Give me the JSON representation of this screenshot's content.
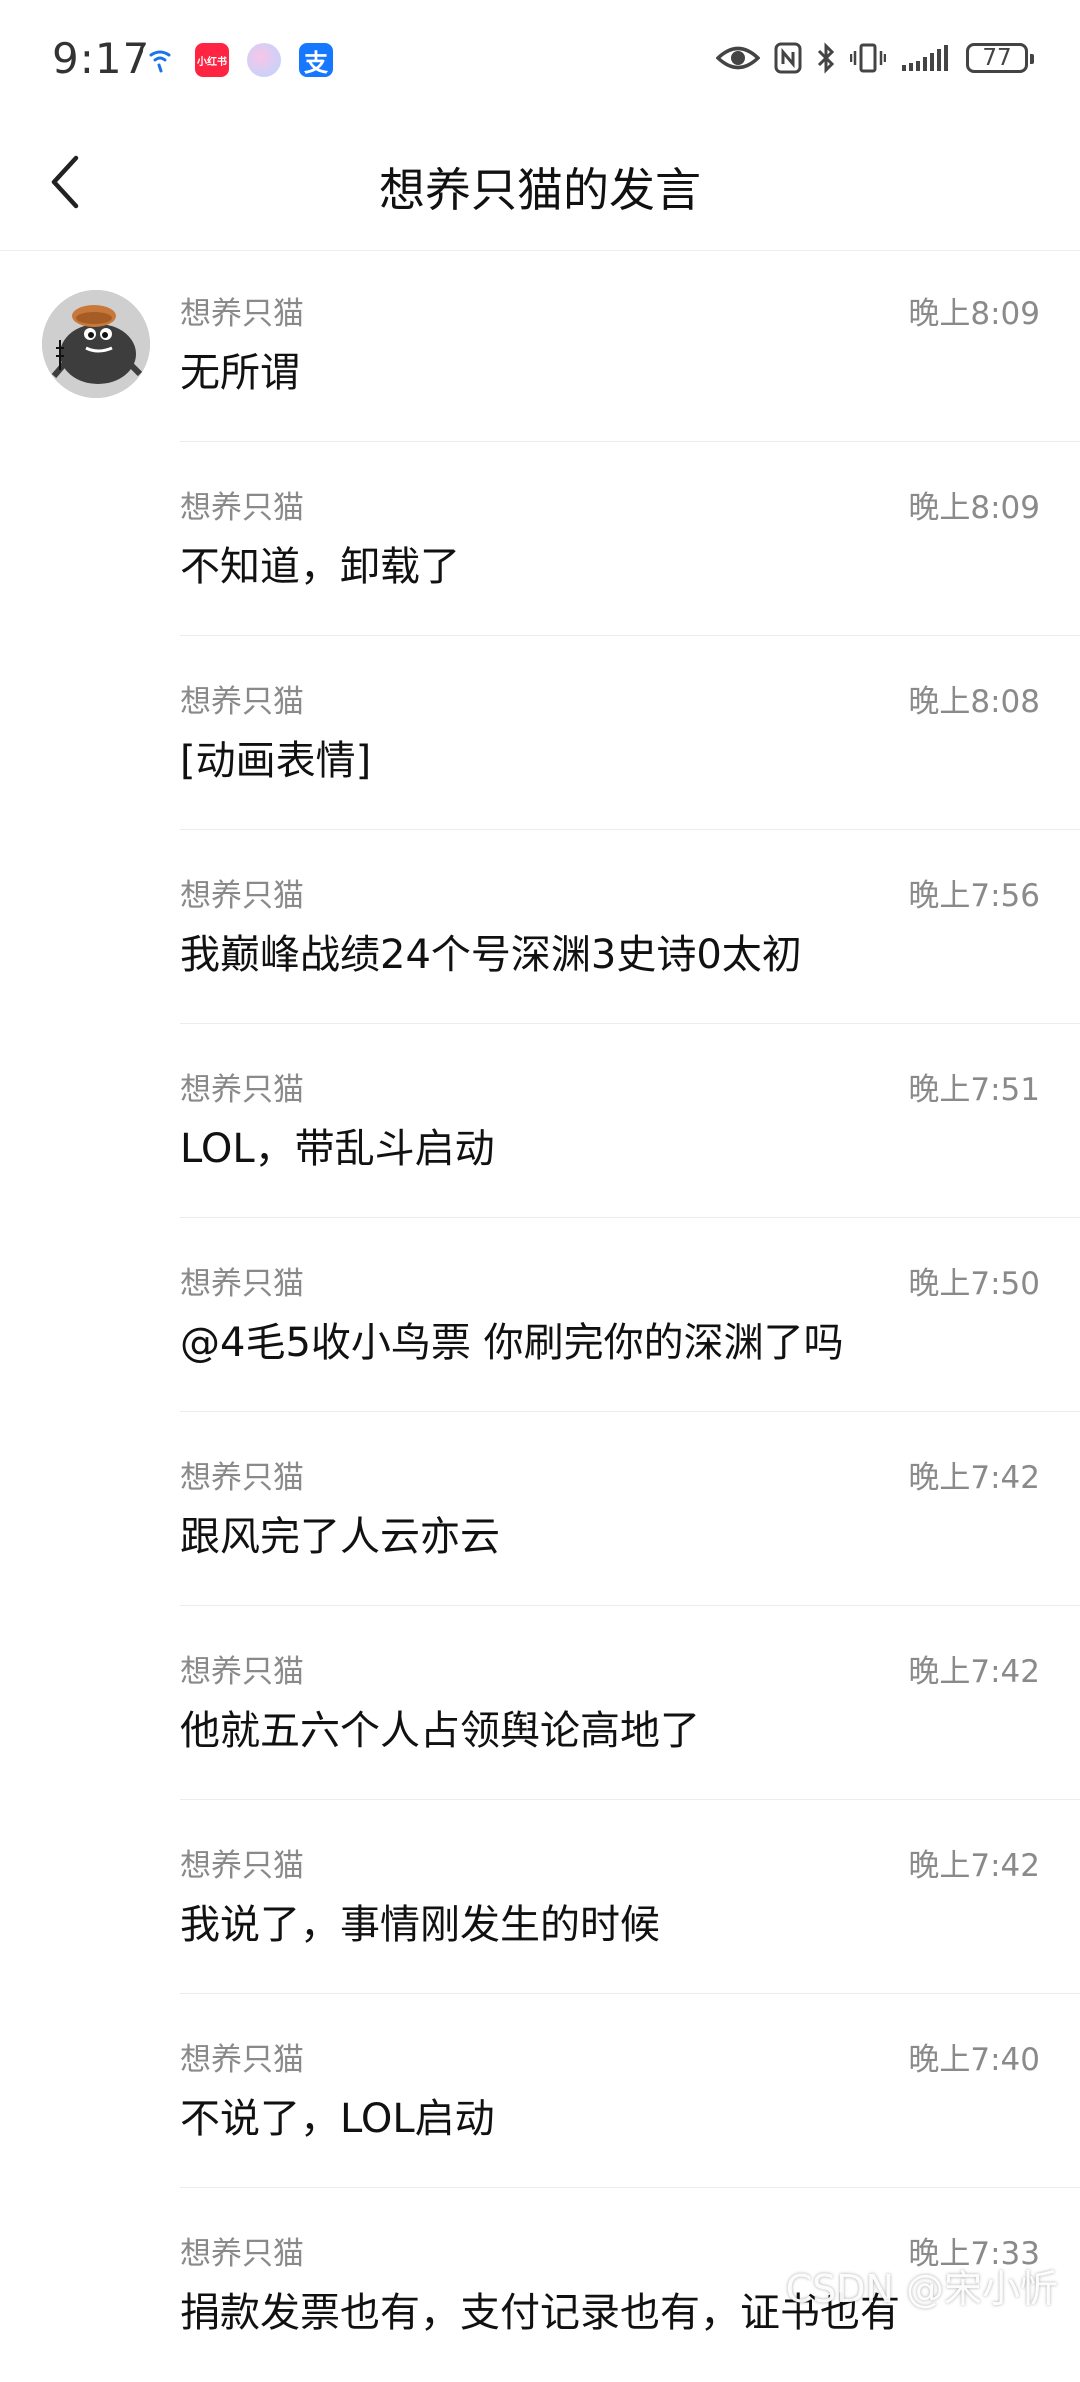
{
  "status_bar": {
    "time": "9:17",
    "battery": "77",
    "app_badges": [
      "小红书"
    ]
  },
  "header": {
    "title": "想养只猫的发言"
  },
  "messages": [
    {
      "sender": "想养只猫",
      "time": "晚上8:09",
      "text": "无所谓"
    },
    {
      "sender": "想养只猫",
      "time": "晚上8:09",
      "text": "不知道，卸载了"
    },
    {
      "sender": "想养只猫",
      "time": "晚上8:08",
      "text": "[动画表情]"
    },
    {
      "sender": "想养只猫",
      "time": "晚上7:56",
      "text": "我巅峰战绩24个号深渊3史诗0太初"
    },
    {
      "sender": "想养只猫",
      "time": "晚上7:51",
      "text": "LOL，带乱斗启动"
    },
    {
      "sender": "想养只猫",
      "time": "晚上7:50",
      "text": "@4毛5收小鸟票 你刷完你的深渊了吗"
    },
    {
      "sender": "想养只猫",
      "time": "晚上7:42",
      "text": "跟风完了人云亦云"
    },
    {
      "sender": "想养只猫",
      "time": "晚上7:42",
      "text": "他就五六个人占领舆论高地了"
    },
    {
      "sender": "想养只猫",
      "time": "晚上7:42",
      "text": "我说了，事情刚发生的时候"
    },
    {
      "sender": "想养只猫",
      "time": "晚上7:40",
      "text": "不说了，LOL启动"
    },
    {
      "sender": "想养只猫",
      "time": "晚上7:33",
      "text": "捐款发票也有，支付记录也有，证书也有"
    }
  ],
  "watermark": "CSDN @宋小忻"
}
